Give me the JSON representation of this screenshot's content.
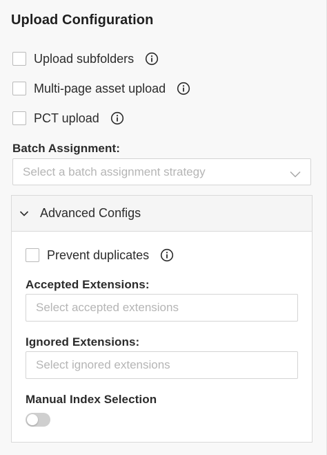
{
  "upload_config": {
    "title": "Upload Configuration",
    "options": [
      {
        "label": "Upload subfolders",
        "checked": false,
        "icon": "info-icon"
      },
      {
        "label": "Multi-page asset upload",
        "checked": false,
        "icon": "info-icon"
      },
      {
        "label": "PCT upload",
        "checked": false,
        "icon": "info-icon"
      }
    ],
    "batch_assignment": {
      "label": "Batch Assignment:",
      "placeholder": "Select a batch assignment strategy",
      "icon": "chevron-down-icon"
    }
  },
  "advanced": {
    "header": "Advanced Configs",
    "expanded": true,
    "header_icon": "chevron-down-icon",
    "prevent_duplicates": {
      "label": "Prevent duplicates",
      "checked": false,
      "icon": "info-icon"
    },
    "accepted_extensions": {
      "label": "Accepted Extensions:",
      "placeholder": "Select accepted extensions"
    },
    "ignored_extensions": {
      "label": "Ignored Extensions:",
      "placeholder": "Select ignored extensions"
    },
    "manual_index": {
      "label": "Manual Index Selection",
      "enabled": false
    }
  },
  "colors": {
    "background": "#f8f8f8",
    "panel": "#ffffff",
    "border": "#d9d9d9",
    "placeholder": "#b5b5b5",
    "toggle_off": "#cfcfcf"
  }
}
